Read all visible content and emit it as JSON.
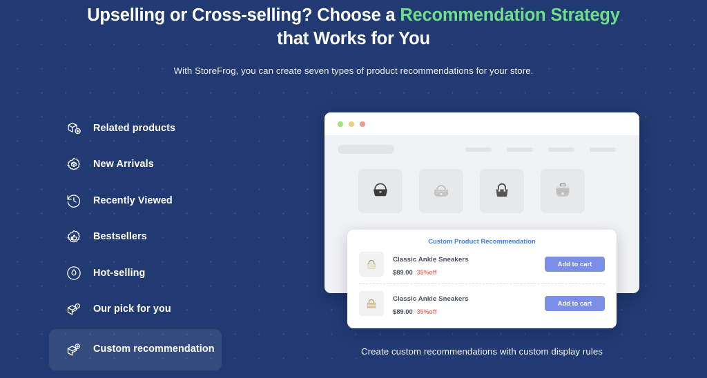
{
  "header": {
    "headline_part1": "Upselling or Cross-selling? Choose a ",
    "headline_accent1": "Recommendation Strategy",
    "headline_part2": " that Works for You",
    "subhead": "With StoreFrog, you can create seven types of product recommendations for your store.",
    "accent_color": "#6fdd8b"
  },
  "strategies": [
    {
      "label": "Related products",
      "icon": "box-plus-icon",
      "selected": false
    },
    {
      "label": "New Arrivals",
      "icon": "box-badge-icon",
      "selected": false
    },
    {
      "label": "Recently Viewed",
      "icon": "clock-rewind-icon",
      "selected": false
    },
    {
      "label": "Bestsellers",
      "icon": "thumbs-up-badge-icon",
      "selected": false
    },
    {
      "label": "Hot-selling",
      "icon": "flame-badge-icon",
      "selected": false
    },
    {
      "label": "Our pick for you",
      "icon": "box-star-icon",
      "selected": false
    },
    {
      "label": "Custom recommendation",
      "icon": "box-gear-icon",
      "selected": true
    }
  ],
  "browser_mock": {
    "window_dots": [
      "green",
      "yellow",
      "red"
    ],
    "skeleton_nav_count": 4,
    "product_tiles": [
      {
        "name": "hobo-bag",
        "tone": "dark"
      },
      {
        "name": "quilted-bag",
        "tone": "light"
      },
      {
        "name": "tote-bag",
        "tone": "dark"
      },
      {
        "name": "satchel-bag",
        "tone": "light"
      }
    ]
  },
  "recommendation_panel": {
    "title": "Custom Product Recommendation",
    "title_color": "#3b7de8",
    "button_color": "#7b8fe8",
    "discount_color": "#f5776a",
    "rows": [
      {
        "thumb": "tote-bag-cream",
        "name": "Classic Ankle Sneakers",
        "price": "$89.00",
        "discount": "35%off",
        "button_label": "Add to cart"
      },
      {
        "thumb": "handbag-tan",
        "name": "Classic Ankle Sneakers",
        "price": "$89.00",
        "discount": "35%off",
        "button_label": "Add to cart"
      }
    ]
  },
  "mock_caption": "Create custom recommendations with custom display rules"
}
